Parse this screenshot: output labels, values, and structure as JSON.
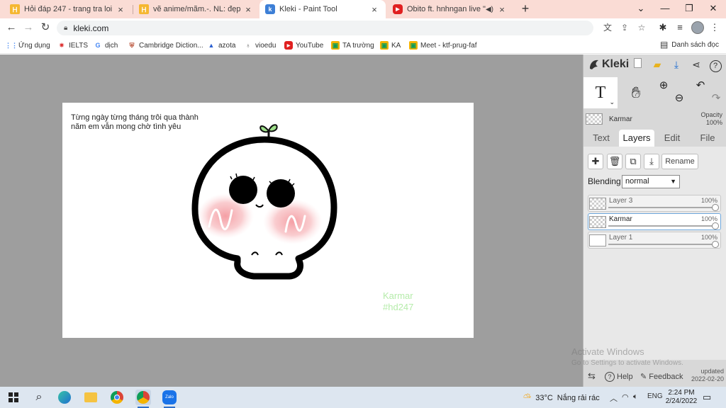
{
  "browser": {
    "tabs": [
      {
        "title": "Hỏi đáp 247 - trang tra loi",
        "favicon": "hoidap-icon"
      },
      {
        "title": "vẽ anime/mãm.-. NL: đẹp dó.-. lá",
        "favicon": "hoidap-icon"
      },
      {
        "title": "Kleki - Paint Tool",
        "favicon": "kleki-icon",
        "active": true
      },
      {
        "title": "Obito ft. hnhngan live \"YOUR",
        "favicon": "youtube-icon"
      }
    ],
    "new_tab_symbol": "+",
    "url": "kleki.com",
    "bookmarks": [
      {
        "label": "Ứng dụng",
        "icon": "apps-grid-icon"
      },
      {
        "label": "IELTS",
        "icon": "ielts-icon"
      },
      {
        "label": "dịch",
        "icon": "google-icon"
      },
      {
        "label": "Cambridge Diction...",
        "icon": "cambridge-icon"
      },
      {
        "label": "azota",
        "icon": "azota-icon"
      },
      {
        "label": "vioedu",
        "icon": "vioedu-icon"
      },
      {
        "label": "YouTube",
        "icon": "youtube-icon"
      },
      {
        "label": "TA trường",
        "icon": "classroom-icon"
      },
      {
        "label": "KA",
        "icon": "classroom-icon"
      },
      {
        "label": "Meet - ktf-prug-faf",
        "icon": "classroom-icon"
      }
    ],
    "reading_list": "Danh sách đọc"
  },
  "canvas": {
    "caption": "Từng ngày từng tháng trôi qua thành năm em vẫn mong chờ tình yêu",
    "watermark_name": "Karmar",
    "watermark_tag": "#hd247"
  },
  "kleki": {
    "logo": "Kleki",
    "current_layer_name": "Karmar",
    "opacity_label": "Opacity",
    "opacity_value": "100%",
    "tabs": [
      "Text",
      "Layers",
      "Edit",
      "File"
    ],
    "active_tab": "Layers",
    "rename_label": "Rename",
    "blending_label": "Blending",
    "blending_value": "normal",
    "layers": [
      {
        "name": "Layer 3",
        "opacity": "100%"
      },
      {
        "name": "Karmar",
        "opacity": "100%",
        "selected": true
      },
      {
        "name": "Layer 1",
        "opacity": "100%"
      }
    ],
    "help_label": "Help",
    "feedback_label": "Feedback",
    "updated_label": "updated",
    "updated_date": "2022-02-20"
  },
  "windows": {
    "activate_title": "Activate Windows",
    "activate_sub": "Go to Settings to activate Windows.",
    "weather_temp": "33°C",
    "weather_text": "Nắng rải rác",
    "language": "ENG",
    "time": "2:24 PM",
    "date": "2/24/2022",
    "taskbar_label_zalo": "Zalo"
  },
  "colors": {
    "tab_strip": "#fadcd5",
    "workspace": "#9e9e9e",
    "panel": "#d8d8d8",
    "watermark": "#b6ecab",
    "accent_blue": "#2e6fc9"
  }
}
